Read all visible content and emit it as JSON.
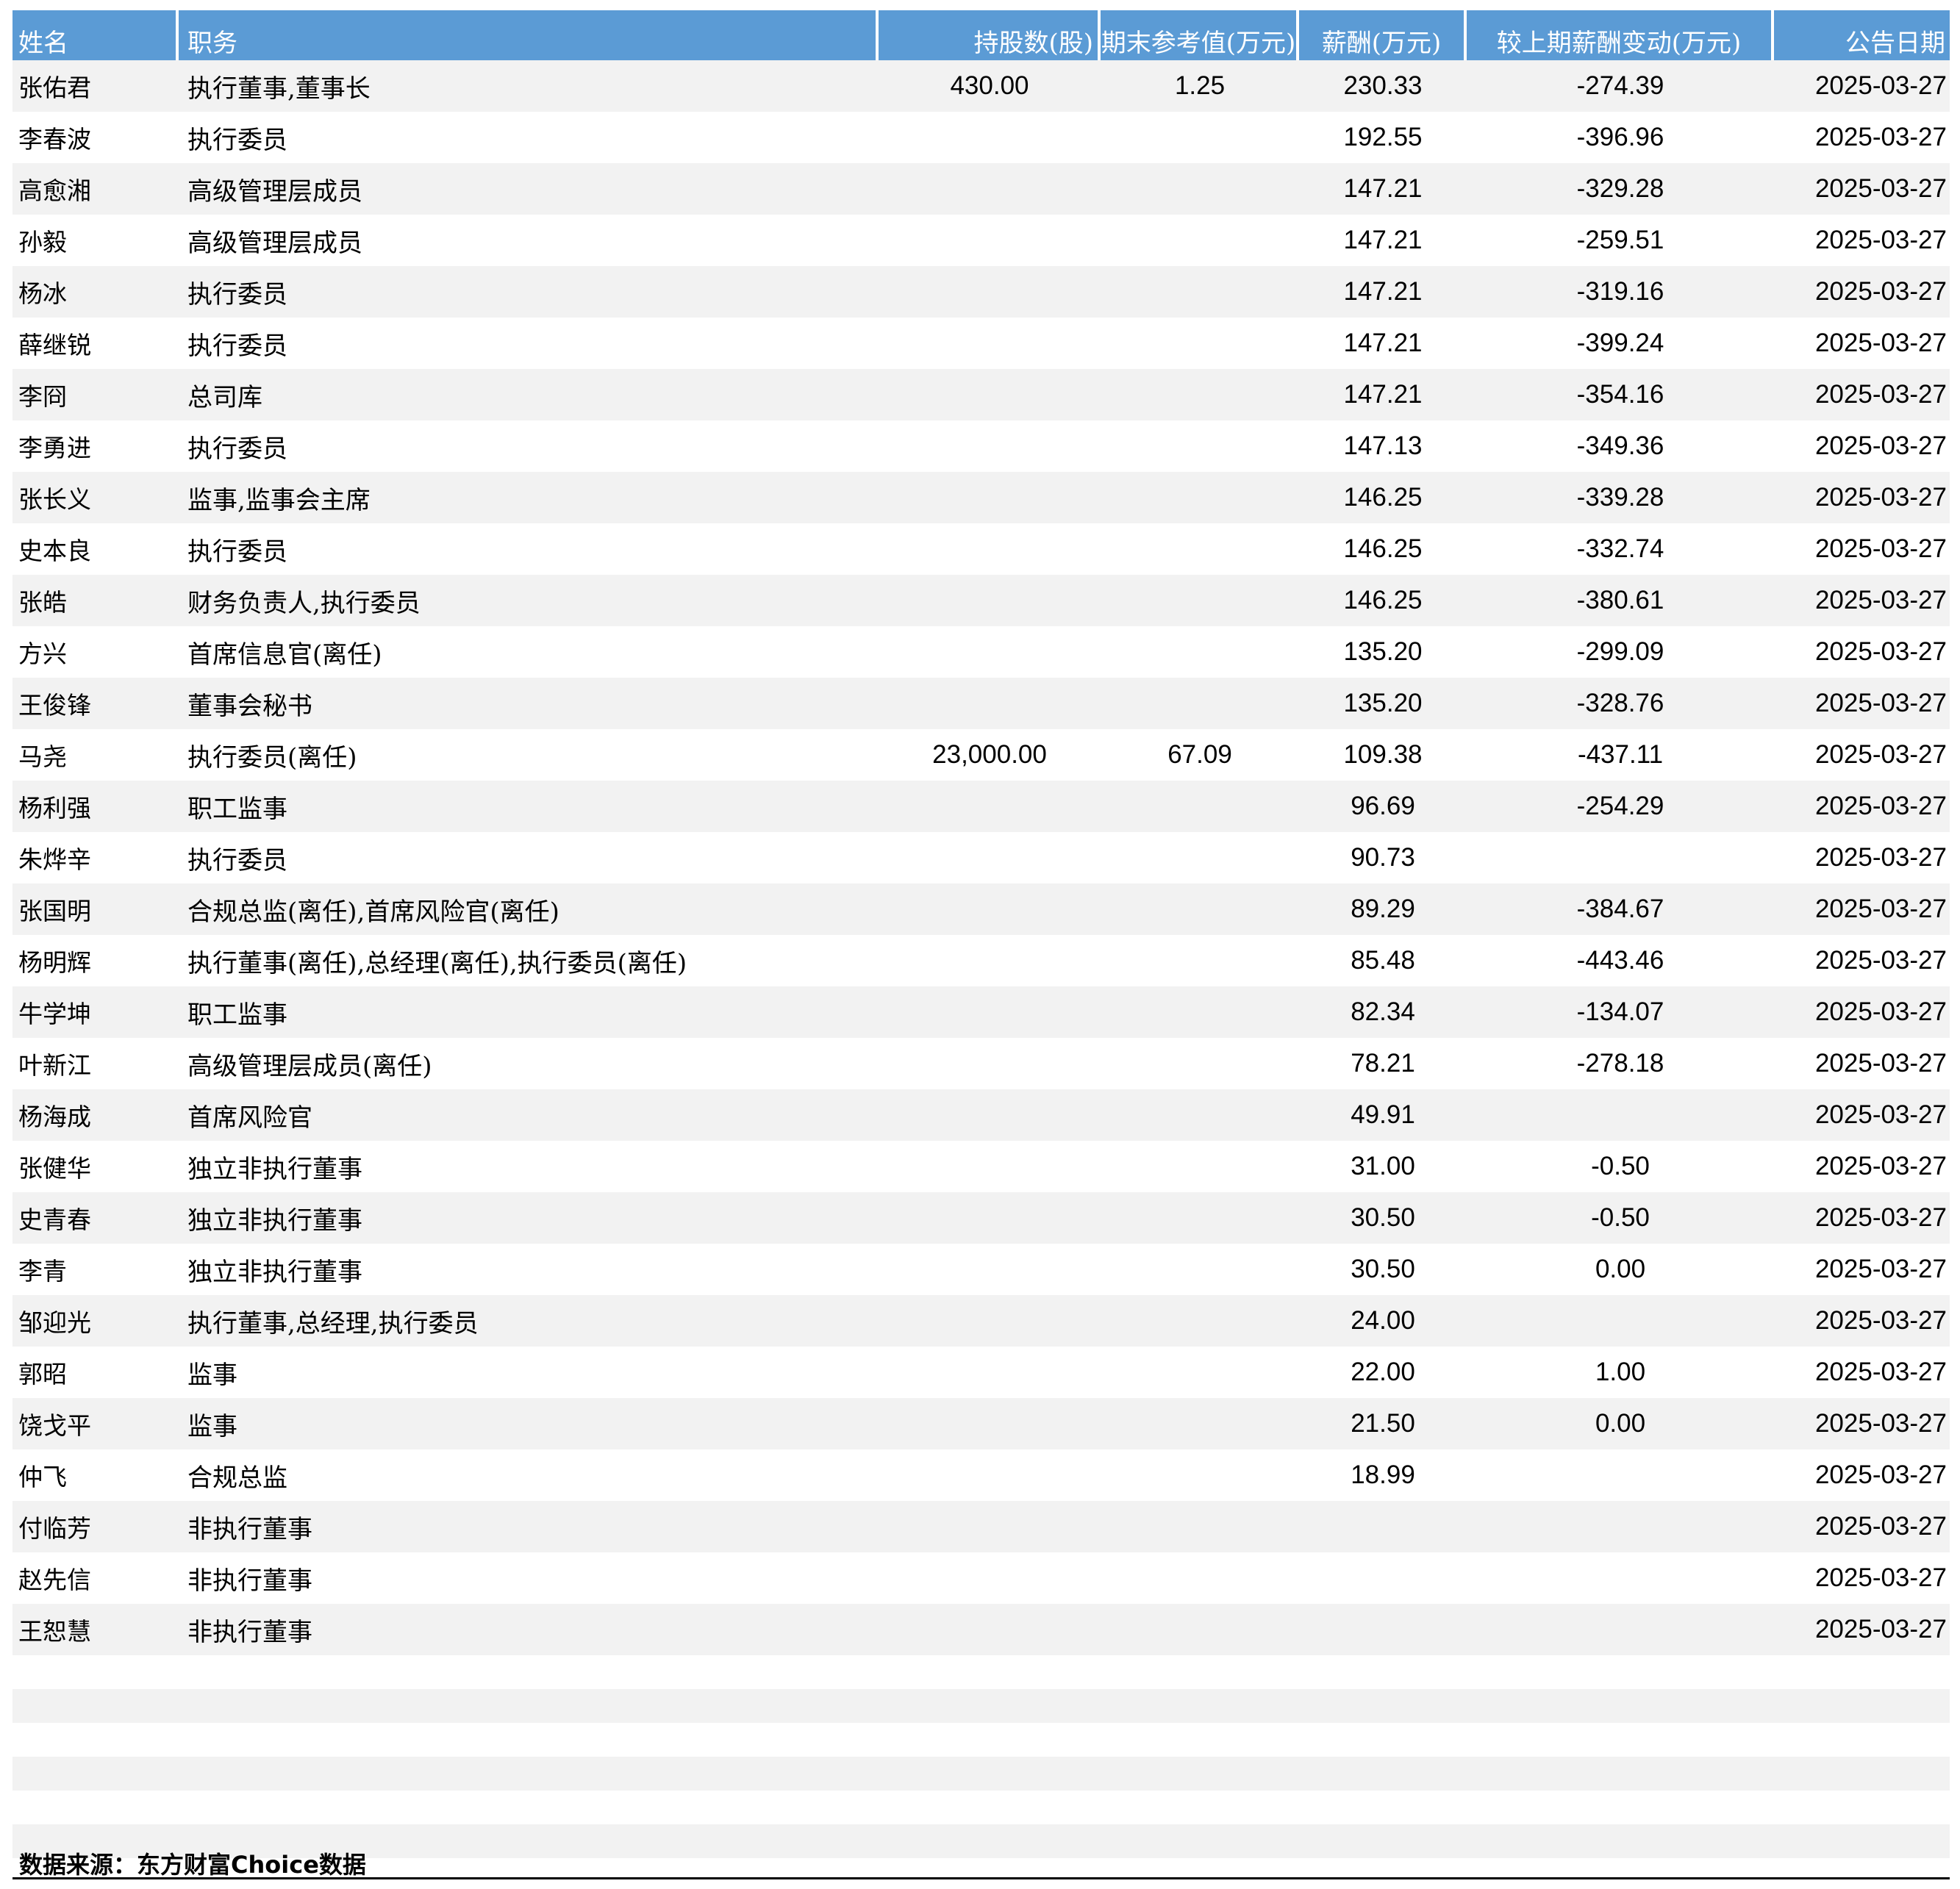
{
  "header": {
    "name": "姓名",
    "position": "职务",
    "shares": "持股数(股)",
    "ref_value": "期末参考值(万元)",
    "salary": "薪酬(万元)",
    "salary_change": "较上期薪酬变动(万元)",
    "date": "公告日期"
  },
  "rows": [
    {
      "name": "张佑君",
      "position": "执行董事,董事长",
      "shares": "430.00",
      "ref_value": "1.25",
      "salary": "230.33",
      "change": "-274.39",
      "date": "2025-03-27"
    },
    {
      "name": "李春波",
      "position": "执行委员",
      "shares": "",
      "ref_value": "",
      "salary": "192.55",
      "change": "-396.96",
      "date": "2025-03-27"
    },
    {
      "name": "高愈湘",
      "position": "高级管理层成员",
      "shares": "",
      "ref_value": "",
      "salary": "147.21",
      "change": "-329.28",
      "date": "2025-03-27"
    },
    {
      "name": "孙毅",
      "position": "高级管理层成员",
      "shares": "",
      "ref_value": "",
      "salary": "147.21",
      "change": "-259.51",
      "date": "2025-03-27"
    },
    {
      "name": "杨冰",
      "position": "执行委员",
      "shares": "",
      "ref_value": "",
      "salary": "147.21",
      "change": "-319.16",
      "date": "2025-03-27"
    },
    {
      "name": "薛继锐",
      "position": "执行委员",
      "shares": "",
      "ref_value": "",
      "salary": "147.21",
      "change": "-399.24",
      "date": "2025-03-27"
    },
    {
      "name": "李冏",
      "position": "总司库",
      "shares": "",
      "ref_value": "",
      "salary": "147.21",
      "change": "-354.16",
      "date": "2025-03-27"
    },
    {
      "name": "李勇进",
      "position": "执行委员",
      "shares": "",
      "ref_value": "",
      "salary": "147.13",
      "change": "-349.36",
      "date": "2025-03-27"
    },
    {
      "name": "张长义",
      "position": "监事,监事会主席",
      "shares": "",
      "ref_value": "",
      "salary": "146.25",
      "change": "-339.28",
      "date": "2025-03-27"
    },
    {
      "name": "史本良",
      "position": "执行委员",
      "shares": "",
      "ref_value": "",
      "salary": "146.25",
      "change": "-332.74",
      "date": "2025-03-27"
    },
    {
      "name": "张皓",
      "position": "财务负责人,执行委员",
      "shares": "",
      "ref_value": "",
      "salary": "146.25",
      "change": "-380.61",
      "date": "2025-03-27"
    },
    {
      "name": "方兴",
      "position": "首席信息官(离任)",
      "shares": "",
      "ref_value": "",
      "salary": "135.20",
      "change": "-299.09",
      "date": "2025-03-27"
    },
    {
      "name": "王俊锋",
      "position": "董事会秘书",
      "shares": "",
      "ref_value": "",
      "salary": "135.20",
      "change": "-328.76",
      "date": "2025-03-27"
    },
    {
      "name": "马尧",
      "position": "执行委员(离任)",
      "shares": "23,000.00",
      "ref_value": "67.09",
      "salary": "109.38",
      "change": "-437.11",
      "date": "2025-03-27"
    },
    {
      "name": "杨利强",
      "position": "职工监事",
      "shares": "",
      "ref_value": "",
      "salary": "96.69",
      "change": "-254.29",
      "date": "2025-03-27"
    },
    {
      "name": "朱烨辛",
      "position": "执行委员",
      "shares": "",
      "ref_value": "",
      "salary": "90.73",
      "change": "",
      "date": "2025-03-27"
    },
    {
      "name": "张国明",
      "position": "合规总监(离任),首席风险官(离任)",
      "shares": "",
      "ref_value": "",
      "salary": "89.29",
      "change": "-384.67",
      "date": "2025-03-27"
    },
    {
      "name": "杨明辉",
      "position": "执行董事(离任),总经理(离任),执行委员(离任)",
      "shares": "",
      "ref_value": "",
      "salary": "85.48",
      "change": "-443.46",
      "date": "2025-03-27"
    },
    {
      "name": "牛学坤",
      "position": "职工监事",
      "shares": "",
      "ref_value": "",
      "salary": "82.34",
      "change": "-134.07",
      "date": "2025-03-27"
    },
    {
      "name": "叶新江",
      "position": "高级管理层成员(离任)",
      "shares": "",
      "ref_value": "",
      "salary": "78.21",
      "change": "-278.18",
      "date": "2025-03-27"
    },
    {
      "name": "杨海成",
      "position": "首席风险官",
      "shares": "",
      "ref_value": "",
      "salary": "49.91",
      "change": "",
      "date": "2025-03-27"
    },
    {
      "name": "张健华",
      "position": "独立非执行董事",
      "shares": "",
      "ref_value": "",
      "salary": "31.00",
      "change": "-0.50",
      "date": "2025-03-27"
    },
    {
      "name": "史青春",
      "position": "独立非执行董事",
      "shares": "",
      "ref_value": "",
      "salary": "30.50",
      "change": "-0.50",
      "date": "2025-03-27"
    },
    {
      "name": "李青",
      "position": "独立非执行董事",
      "shares": "",
      "ref_value": "",
      "salary": "30.50",
      "change": "0.00",
      "date": "2025-03-27"
    },
    {
      "name": "邹迎光",
      "position": "执行董事,总经理,执行委员",
      "shares": "",
      "ref_value": "",
      "salary": "24.00",
      "change": "",
      "date": "2025-03-27"
    },
    {
      "name": "郭昭",
      "position": "监事",
      "shares": "",
      "ref_value": "",
      "salary": "22.00",
      "change": "1.00",
      "date": "2025-03-27"
    },
    {
      "name": "饶戈平",
      "position": "监事",
      "shares": "",
      "ref_value": "",
      "salary": "21.50",
      "change": "0.00",
      "date": "2025-03-27"
    },
    {
      "name": "仲飞",
      "position": "合规总监",
      "shares": "",
      "ref_value": "",
      "salary": "18.99",
      "change": "",
      "date": "2025-03-27"
    },
    {
      "name": "付临芳",
      "position": "非执行董事",
      "shares": "",
      "ref_value": "",
      "salary": "",
      "change": "",
      "date": "2025-03-27"
    },
    {
      "name": "赵先信",
      "position": "非执行董事",
      "shares": "",
      "ref_value": "",
      "salary": "",
      "change": "",
      "date": "2025-03-27"
    },
    {
      "name": "王恕慧",
      "position": "非执行董事",
      "shares": "",
      "ref_value": "",
      "salary": "",
      "change": "",
      "date": "2025-03-27"
    }
  ],
  "source": "数据来源：东方财富Choice数据"
}
